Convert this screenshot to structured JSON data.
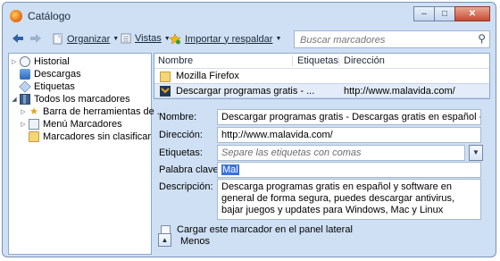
{
  "window": {
    "title": "Catálogo"
  },
  "window_buttons": {
    "minimize": "‒",
    "maximize": "□",
    "close": "✕"
  },
  "toolbar": {
    "organize": "Organizar",
    "views": "Vistas",
    "import_backup": "Importar y respaldar",
    "search_placeholder": "Buscar marcadores"
  },
  "tree": {
    "items": [
      {
        "label": "Historial"
      },
      {
        "label": "Descargas"
      },
      {
        "label": "Etiquetas"
      },
      {
        "label": "Todos los marcadores"
      },
      {
        "label": "Barra de herramientas de ..."
      },
      {
        "label": "Menú Marcadores"
      },
      {
        "label": "Marcadores sin clasificar"
      }
    ]
  },
  "list": {
    "columns": [
      "Nombre",
      "Etiquetas",
      "Dirección"
    ],
    "rows": [
      {
        "name": "Mozilla Firefox",
        "tags": "",
        "address": ""
      },
      {
        "name": "Descargar programas gratis - ...",
        "tags": "",
        "address": "http://www.malavida.com/"
      }
    ]
  },
  "details": {
    "name_label": "Nombre:",
    "name_value": "Descargar programas gratis - Descargas gratis en español - Malavida",
    "address_label": "Dirección:",
    "address_value": "http://www.malavida.com/",
    "tags_label": "Etiquetas:",
    "tags_placeholder": "Separe las etiquetas con comas",
    "keyword_label": "Palabra clave:",
    "keyword_value": "Mal",
    "description_label": "Descripción:",
    "description_value": "Descarga programas gratis en español y software en general de forma segura, puedes descargar antivirus, bajar juegos y updates para Windows, Mac y Linux",
    "sidebar_checkbox_label": "Cargar este marcador en el panel lateral",
    "less_button": "Menos"
  }
}
